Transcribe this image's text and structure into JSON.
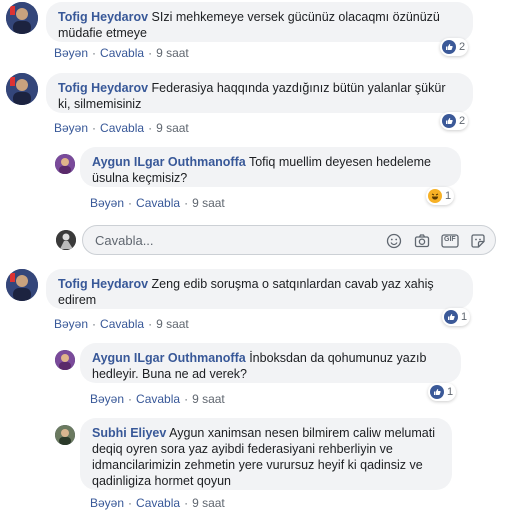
{
  "labels": {
    "like": "Bəyən",
    "reply": "Cavabla",
    "separator": "·"
  },
  "comments": [
    {
      "author": "Tofig Heydarov",
      "text_l1": "SIzi mehkemeye versek gücünüz olacaqmı özünüzü",
      "text_l2": "müdafie etmeye",
      "time": "9 saat",
      "reactions": {
        "type": "like",
        "count": "2"
      }
    },
    {
      "author": "Tofig Heydarov",
      "text_l1": "Federasiya haqqında yazdığınız bütün yalanlar şükür",
      "text_l2": "ki, silmemisiniz",
      "time": "9 saat",
      "reactions": {
        "type": "like",
        "count": "2"
      }
    },
    {
      "author": "Aygun ILgar Outhmanoffa",
      "text_l1": "Tofiq muellim deyesen hedeleme",
      "text_l2": "üsulna keçmisiz?",
      "time": "9 saat",
      "reactions": {
        "type": "haha",
        "count": "1"
      }
    },
    {
      "author": "Tofig Heydarov",
      "text_l1": "Zeng edib soruşma o satqınlardan cavab yaz xahiş",
      "text_l2": "edirem",
      "time": "9 saat",
      "reactions": {
        "type": "like",
        "count": "1"
      }
    },
    {
      "author": "Aygun ILgar Outhmanoffa",
      "text_l1": "İnboksdan da qohumunuz yazıb",
      "text_l2": "hedleyir. Buna ne ad verek?",
      "time": "9 saat",
      "reactions": {
        "type": "like",
        "count": "1"
      }
    },
    {
      "author": "Subhi Eliyev",
      "text_l1": "Aygun xanimsan nesen bilmirem caliw melumati",
      "text_l2": "deqiq oyren sora yaz ayibdi federasiyani rehberliyin ve",
      "text_l3": "idmancilarimizin zehmetin yere vurursuz heyif ki qadinsiz ve",
      "text_l4": "qadinligiza hormet qoyun",
      "time": "9 saat"
    }
  ],
  "reply_box": {
    "placeholder": "Cavabla...",
    "gif_label": "GIF"
  },
  "icons": [
    "emoji-icon",
    "camera-icon",
    "gif-icon",
    "sticker-icon"
  ],
  "colors": {
    "link": "#385898",
    "bubble": "#f2f3f5",
    "like": "#3b5998",
    "haha": "#f7b125"
  }
}
